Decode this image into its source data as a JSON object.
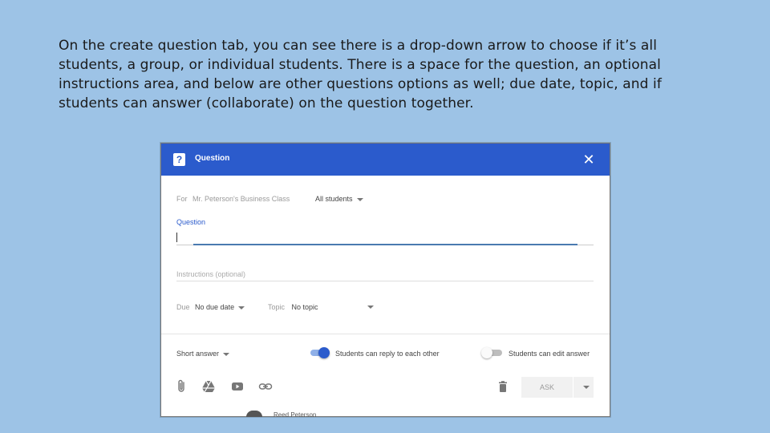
{
  "caption": "On the create question tab, you can see there is a drop-down arrow to choose if it’s all students, a group, or individual students. There is a space for the question, an optional instructions area, and below are other questions options as well; due date, topic, and if students can answer (collaborate) on the question together.",
  "dialog": {
    "title": "Question",
    "for_label": "For",
    "class_name": "Mr. Peterson's Business Class",
    "audience": "All students",
    "question_label": "Question",
    "question_value": "",
    "instructions_placeholder": "Instructions (optional)",
    "due_label": "Due",
    "due_value": "No due date",
    "topic_label": "Topic",
    "topic_value": "No topic",
    "answer_type": "Short answer",
    "reply_toggle": {
      "label": "Students can reply to each other",
      "on": true
    },
    "edit_toggle": {
      "label": "Students can edit answer",
      "on": false
    },
    "ask_label": "ASK",
    "footer_partial_text": "Reed Peterson"
  },
  "colors": {
    "background": "#9dc3e6",
    "titlebar": "#2b5bcc",
    "accent": "#2b5bcc"
  },
  "icons": [
    "question-icon",
    "close-icon",
    "attachment-icon",
    "drive-icon",
    "youtube-icon",
    "link-icon",
    "trash-icon",
    "chevron-down-icon"
  ]
}
